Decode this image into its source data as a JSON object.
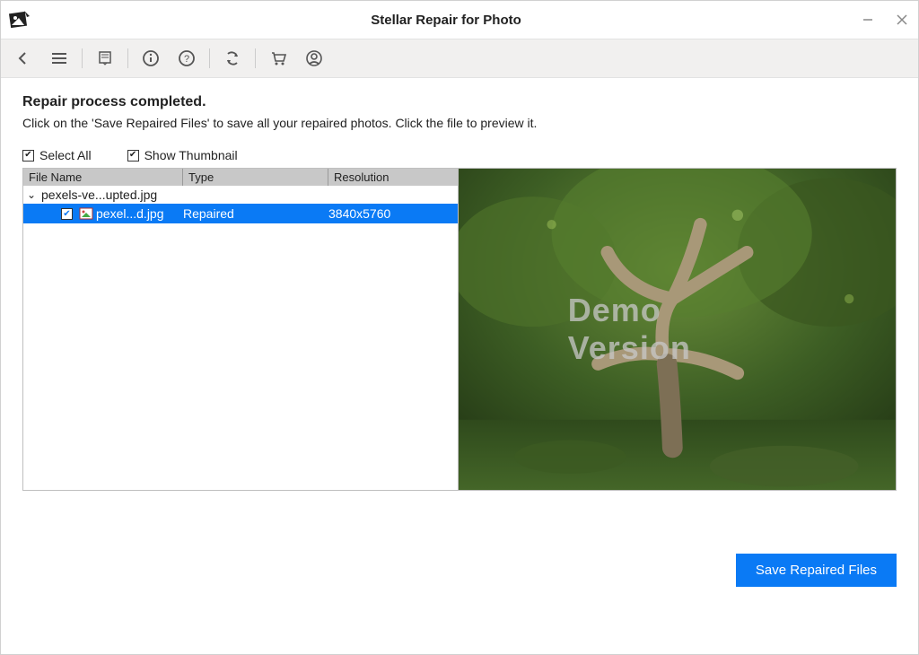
{
  "app": {
    "title": "Stellar Repair for Photo"
  },
  "messages": {
    "heading": "Repair process completed.",
    "subheading": "Click on the 'Save Repaired Files' to save all your repaired photos. Click the file to preview it."
  },
  "options": {
    "select_all": "Select All",
    "show_thumbnail": "Show Thumbnail"
  },
  "table": {
    "headers": {
      "name": "File Name",
      "type": "Type",
      "resolution": "Resolution"
    },
    "parent": "pexels-ve...upted.jpg",
    "child": {
      "name": "pexel...d.jpg",
      "type": "Repaired",
      "resolution": "3840x5760",
      "selected": true
    }
  },
  "preview": {
    "watermark": "Demo Version"
  },
  "buttons": {
    "save": "Save Repaired Files"
  }
}
